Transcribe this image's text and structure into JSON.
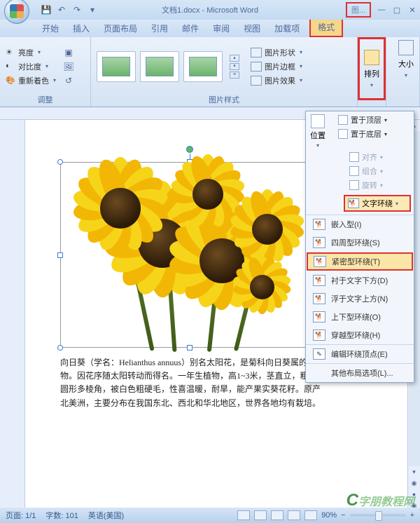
{
  "window": {
    "title": "文档1.docx - Microsoft Word",
    "tools_label": "图..."
  },
  "tabs": {
    "home": "开始",
    "insert": "插入",
    "layout": "页面布局",
    "references": "引用",
    "mailings": "邮件",
    "review": "审阅",
    "view": "视图",
    "addins": "加载项",
    "format": "格式"
  },
  "ribbon": {
    "adjust": {
      "brightness": "亮度",
      "contrast": "对比度",
      "recolor": "重新着色",
      "group_label": "调整"
    },
    "styles": {
      "shape": "图片形状",
      "border": "图片边框",
      "effects": "图片效果",
      "group_label": "图片样式"
    },
    "arrange": {
      "label": "排列"
    },
    "size": {
      "label": "大小"
    }
  },
  "dropdown": {
    "position": "位置",
    "bring_front": "置于顶层",
    "send_back": "置于底层",
    "align": "对齐",
    "group": "组合",
    "rotate": "旋转",
    "text_wrap_btn": "文字环绕",
    "wrap_options": {
      "inline": "嵌入型(I)",
      "square": "四周型环绕(S)",
      "tight": "紧密型环绕(T)",
      "behind": "衬于文字下方(D)",
      "front": "浮于文字上方(N)",
      "topbottom": "上下型环绕(O)",
      "through": "穿越型环绕(H)",
      "edit_points": "编辑环绕顶点(E)",
      "more": "其他布局选项(L)..."
    }
  },
  "document": {
    "paragraph": "向日葵（学名：Helianthus annuus）别名太阳花，是菊科向日葵属的植物。因花序随太阳转动而得名。一年生植物，高1~3米，茎直立，粗壮，圆形多棱角，被白色粗硬毛，性喜温暖，耐旱，能产果实葵花籽。原产北美洲，主要分布在我国东北、西北和华北地区，世界各地均有栽培。"
  },
  "statusbar": {
    "page": "页面: 1/1",
    "words": "字数: 101",
    "lang": "英语(美国)",
    "zoom": "90%"
  },
  "watermark": "字朋教程网"
}
